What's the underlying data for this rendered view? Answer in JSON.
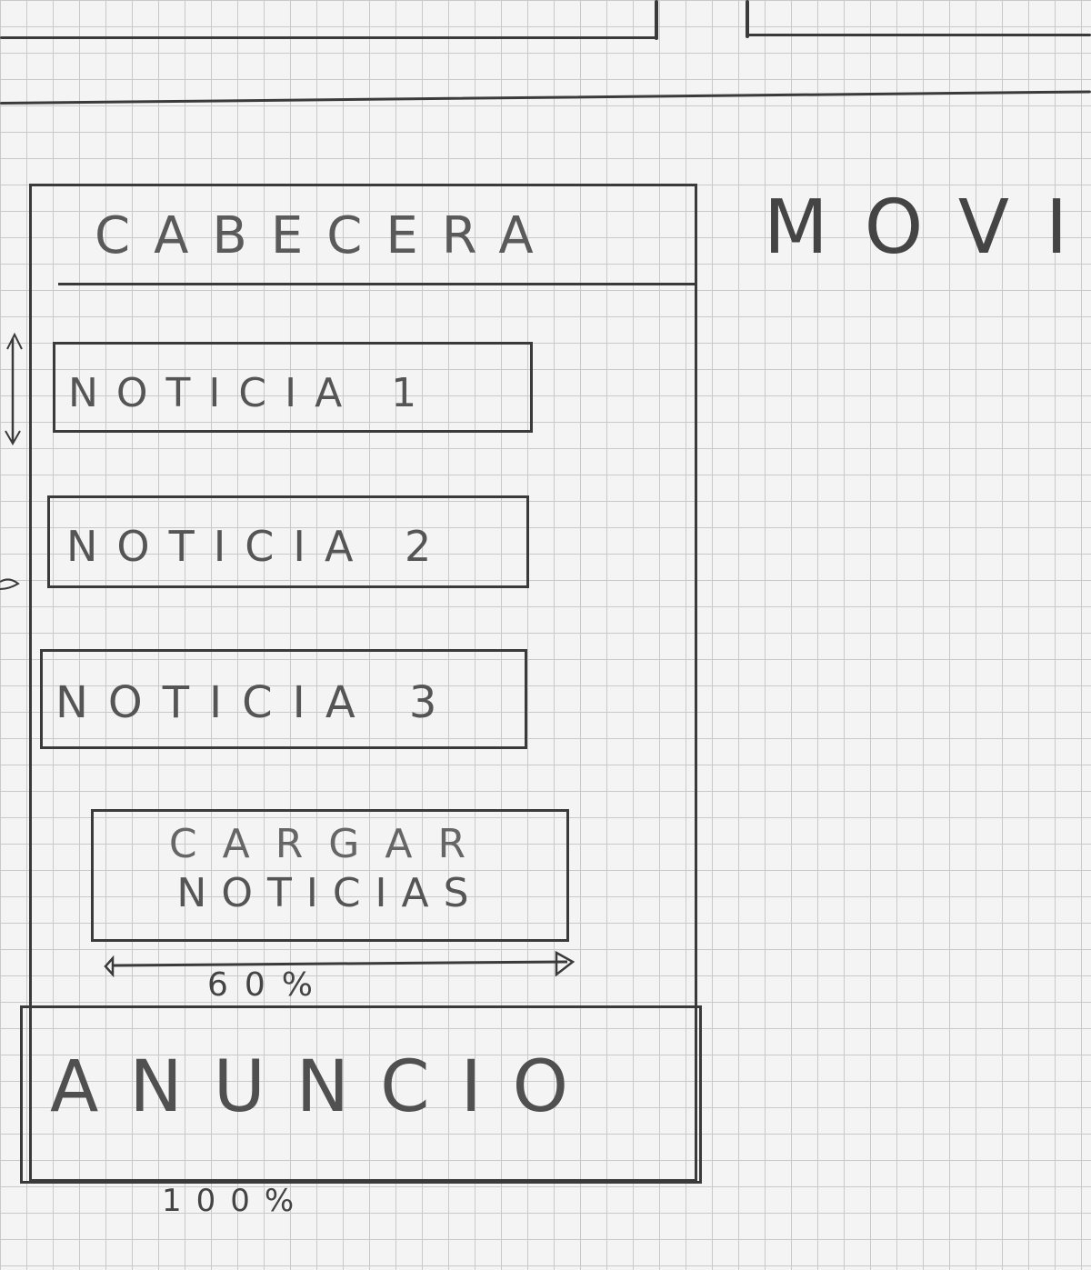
{
  "side_label": "MOVI",
  "header": {
    "label": "CABECERA"
  },
  "news": [
    {
      "label": "NOTICIA 1"
    },
    {
      "label": "NOTICIA 2"
    },
    {
      "label": "NOTICIA 3"
    }
  ],
  "load_button": {
    "line1": "CARGAR",
    "line2": "NOTICIAS"
  },
  "button_width_note": "60%",
  "ad": {
    "label": "ANUNCIO"
  },
  "page_width_note": "100%"
}
